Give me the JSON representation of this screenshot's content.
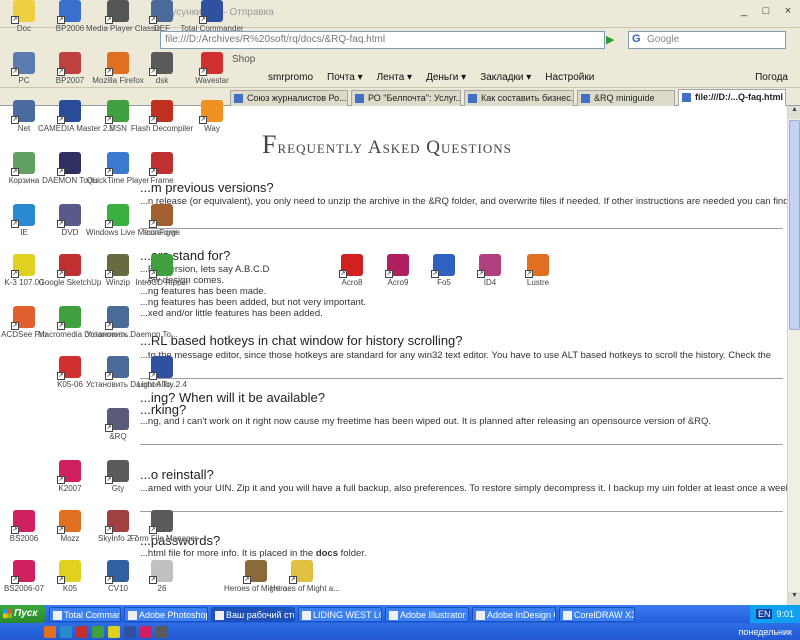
{
  "window": {
    "title": "Бусункиран – Отправка",
    "buttons": [
      "_",
      "□",
      "×"
    ]
  },
  "nav": {
    "url": "file:///D:/Archives/R%20soft/rq/docs/&RQ-faq.html",
    "go": "▶",
    "search_placeholder": "Google",
    "search_brand": "G"
  },
  "bookmarks": {
    "shop": "Shop"
  },
  "toolbar": {
    "items": [
      "smrpromo",
      "Почта ▾",
      "Лента ▾",
      "Деньги ▾",
      "Закладки ▾",
      "Настройки"
    ],
    "weather": "Погода"
  },
  "tabs": [
    {
      "label": "Союз журналистов Ро..."
    },
    {
      "label": "РО \"Белпочта\": Услуг..."
    },
    {
      "label": "Как составить бизнес..."
    },
    {
      "label": "&RQ miniguide"
    },
    {
      "label": "file:///D:/...Q-faq.html",
      "active": true
    }
  ],
  "faq": {
    "title": "Frequently Asked Questions",
    "q1": "...m previous versions?",
    "a1": "...n release (or equivalent), you only need to unzip the archive in the &RQ folder, and overwrite files if needed. If other instructions are needed you can find them in",
    "q2": "...ers stand for?",
    "a2_1": "...RQ version, lets say A.B.C.D",
    "a2_2": "...ew design comes.",
    "a2_3": "...ng features has been made.",
    "a2_4": "...ng features has been added, but not very important.",
    "a2_5": "...xed and/or little features has been added.",
    "q3": "...RL based hotkeys in chat window for history scrolling?",
    "a3": "...to the message editor, since those hotkeys are standard for any win32 text editor. You have to use ALT based hotkeys to scroll the history. Check the",
    "q4": "...ing? When will it be available?",
    "q4b": "...rking?",
    "a4": "...ng, and i can't work on it right now cause my freetime has been wiped out. It is planned after releasing an opensource version of &RQ.",
    "q5": "...o reinstall?",
    "a5": "...amed with your UIN. Zip it and you will have a full backup, also preferences. To restore simply decompress it. I backup my uin folder at least once a week.",
    "q6": "...passwords?",
    "a6_pre": "...html file for more info. It is placed in the ",
    "a6_bold": "docs",
    "a6_post": " folder."
  },
  "desktop_icons": [
    {
      "label": "Doc",
      "color": "#f0d040",
      "icon": "folder-icon"
    },
    {
      "label": "BP2006",
      "color": "#3a6fd0",
      "icon": "globe-icon"
    },
    {
      "label": "Media Player Classic",
      "color": "#555555",
      "icon": "film-icon"
    },
    {
      "label": "DEF",
      "color": "#4a6a9a",
      "icon": "server-icon"
    },
    {
      "label": "Total Commander",
      "color": "#3050a0",
      "icon": "floppy-icon"
    },
    {
      "label": "PC",
      "color": "#5a7ab0",
      "icon": "computer-icon"
    },
    {
      "label": "BP2007",
      "color": "#c04040",
      "icon": "app-icon"
    },
    {
      "label": "Mozilla Firefox",
      "color": "#e07020",
      "icon": "firefox-icon"
    },
    {
      "label": "dsk",
      "color": "#5a5a5a",
      "icon": "app-icon"
    },
    {
      "label": "Wavestar",
      "color": "#d03030",
      "icon": "app-icon"
    },
    {
      "label": "Net",
      "color": "#4a6aa0",
      "icon": "network-icon"
    },
    {
      "label": "CAMEDIA Master 2.5",
      "color": "#2a4a9a",
      "icon": "camera-icon"
    },
    {
      "label": "MSN",
      "color": "#40a040",
      "icon": "messenger-icon"
    },
    {
      "label": "Flash Decompiler",
      "color": "#c03020",
      "icon": "flash-icon"
    },
    {
      "label": "Way",
      "color": "#f09020",
      "icon": "app-icon"
    },
    {
      "label": "Корзина",
      "color": "#60a060",
      "icon": "recycle-bin-icon"
    },
    {
      "label": "DAEMON Tools",
      "color": "#303060",
      "icon": "disc-icon"
    },
    {
      "label": "QuickTime Player",
      "color": "#3a7ad0",
      "icon": "quicktime-icon"
    },
    {
      "label": "Frame",
      "color": "#c03030",
      "icon": "app-icon"
    },
    {
      "label": "IE",
      "color": "#2a8ad0",
      "icon": "ie-icon"
    },
    {
      "label": "DVD",
      "color": "#5a5a8a",
      "icon": "disc-icon"
    },
    {
      "label": "Windows Live Messenger",
      "color": "#3ab040",
      "icon": "messenger-icon"
    },
    {
      "label": "IconForge",
      "color": "#a06030",
      "icon": "app-icon"
    },
    {
      "label": "K-3 107.00",
      "color": "#e0d020",
      "icon": "app-icon"
    },
    {
      "label": "Google SketchUp",
      "color": "#c03030",
      "icon": "sketchup-icon"
    },
    {
      "label": "Winzip",
      "color": "#6a6a40",
      "icon": "archive-icon"
    },
    {
      "label": "IntroCD Ripper",
      "color": "#40a040",
      "icon": "app-icon"
    },
    {
      "label": "ACDSee Pro",
      "color": "#e06030",
      "icon": "acdsee-icon"
    },
    {
      "label": "Macromedia Dreamweav...",
      "color": "#40a040",
      "icon": "dreamweaver-icon"
    },
    {
      "label": "Установить Daemon To...",
      "color": "#4a6a9a",
      "icon": "setup-icon"
    },
    {
      "label": "K05-06",
      "color": "#d03030",
      "icon": "app-icon"
    },
    {
      "label": "Установить Daemon To...",
      "color": "#4a6a9a",
      "icon": "setup-icon"
    },
    {
      "label": "Light Alloy 2.4",
      "color": "#3050a0",
      "icon": "player-icon"
    },
    {
      "label": "&RQ",
      "color": "#5a5a7a",
      "icon": "app-icon"
    },
    {
      "label": "K2007",
      "color": "#d02060",
      "icon": "app-icon"
    },
    {
      "label": "Gty",
      "color": "#5a5a5a",
      "icon": "app-icon"
    },
    {
      "label": "BS2006",
      "color": "#d02060",
      "icon": "app-icon"
    },
    {
      "label": "Mozz",
      "color": "#e07020",
      "icon": "firefox-icon"
    },
    {
      "label": "SkyInfo 2.7",
      "color": "#a04040",
      "icon": "app-icon"
    },
    {
      "label": "Form File Manager",
      "color": "#5a5a5a",
      "icon": "app-icon"
    },
    {
      "label": "BS2006-07",
      "color": "#d02060",
      "icon": "app-icon"
    },
    {
      "label": "K05",
      "color": "#e0d020",
      "icon": "app-icon"
    },
    {
      "label": "CV10",
      "color": "#3060a0",
      "icon": "app-icon"
    },
    {
      "label": "26",
      "color": "#c0c0c0",
      "icon": "gear-icon"
    },
    {
      "label": "Heroes of Might a...",
      "color": "#8a6a3a",
      "icon": "game-icon"
    },
    {
      "label": "Heroes of Might a...",
      "color": "#e0c040",
      "icon": "folder-icon"
    },
    {
      "label": "Acro8",
      "color": "#d02020",
      "icon": "acrobat-icon"
    },
    {
      "label": "Acro9",
      "color": "#b02060",
      "icon": "acrobat-icon"
    },
    {
      "label": "Fo5",
      "color": "#3060c0",
      "icon": "feather-icon"
    },
    {
      "label": "ID4",
      "color": "#b04080",
      "icon": "indesign-icon"
    },
    {
      "label": "Lustre",
      "color": "#e07020",
      "icon": "app-icon"
    }
  ],
  "taskbar": {
    "start": "Пуск",
    "tasks": [
      {
        "label": "Total Commander 7....",
        "color": "#3050a0"
      },
      {
        "label": "Adobe Photoshop CS3",
        "color": "#2a5ab0"
      },
      {
        "label": "Ваш рабочий стол :...",
        "color": "#e07020",
        "active": true
      },
      {
        "label": "LIDING WEST LOGO",
        "color": "#c03030"
      },
      {
        "label": "Adobe Illustrator - [k...",
        "color": "#e08020"
      },
      {
        "label": "Adobe InDesign CS3...",
        "color": "#c04080"
      },
      {
        "label": "CorelDRAW X3",
        "color": "#40a040"
      }
    ],
    "lang": "EN",
    "clock": "9:01",
    "day": "понедельник"
  }
}
